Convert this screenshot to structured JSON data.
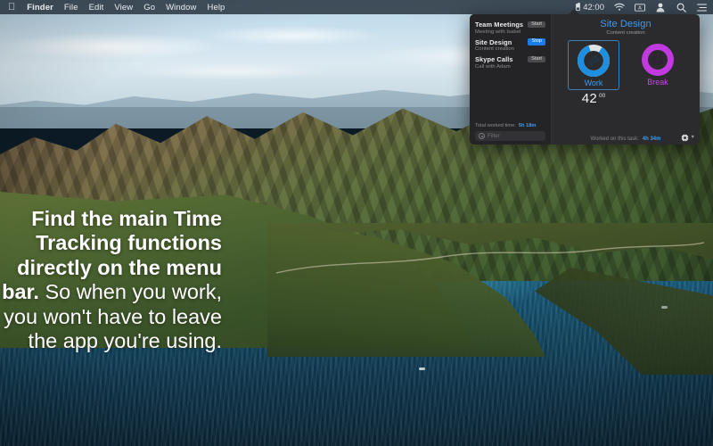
{
  "menubar": {
    "apple_glyph": "",
    "items": [
      {
        "label": "Finder",
        "bold": true
      },
      {
        "label": "File",
        "bold": false
      },
      {
        "label": "Edit",
        "bold": false
      },
      {
        "label": "View",
        "bold": false
      },
      {
        "label": "Go",
        "bold": false
      },
      {
        "label": "Window",
        "bold": false
      },
      {
        "label": "Help",
        "bold": false
      }
    ],
    "clock": "42:00",
    "status_icons": [
      "battery-icon",
      "wifi-icon",
      "keyboard-input-icon",
      "user-account-icon",
      "search-icon",
      "control-center-icon"
    ]
  },
  "panel": {
    "tasks": [
      {
        "name": "Team Meetings",
        "subtitle": "Meeting with Isabel",
        "button": "Start",
        "running": false
      },
      {
        "name": "Site Design",
        "subtitle": "Content creation",
        "button": "Stop",
        "running": true
      },
      {
        "name": "Skype Calls",
        "subtitle": "Call with Adam",
        "button": "Start",
        "running": false
      }
    ],
    "total_label": "Total worked time:",
    "total_value": "5h 18m",
    "filter_placeholder": "Filter",
    "title": "Site Design",
    "subtitle": "Content creation",
    "modes": [
      {
        "label": "Work",
        "icon": "wrench-icon",
        "color": "#1e8fe0",
        "progress": 0.86,
        "selected": true
      },
      {
        "label": "Break",
        "icon": "ping-pong-paddle-icon",
        "color": "#c13ae0",
        "progress": 1.0,
        "selected": false
      }
    ],
    "timer_minutes": "42",
    "timer_seconds": "00",
    "worked_label": "Worked on this task:",
    "worked_value": "4h 34m",
    "settings_icon": "gear-icon",
    "settings_chevron": "chevron-down-icon"
  },
  "caption": {
    "bold_text": "Find the main Time Tracking functions directly on the menu bar.",
    "normal_text": " So when you work, you won't have to leave the app you're using."
  },
  "colors": {
    "accent_blue": "#3e9bf0",
    "stop_blue": "#1a7ced",
    "break_purple": "#c13ae0",
    "panel_bg": "#2b2b2d",
    "panel_side_bg": "#242426"
  }
}
